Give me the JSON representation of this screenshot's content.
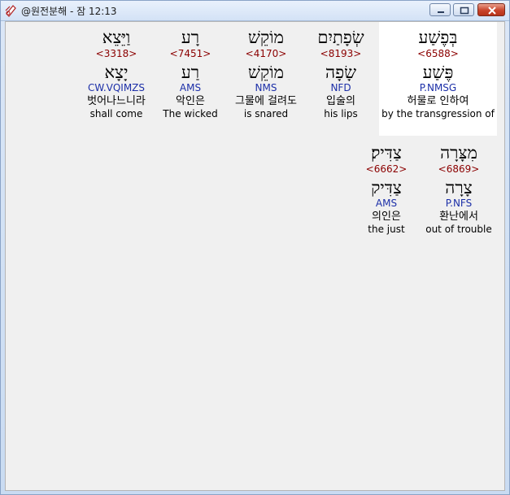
{
  "window": {
    "title": "@원전분해 - 잠 12:13",
    "buttons": {
      "minimize": "minimize-icon",
      "maximize": "maximize-icon",
      "close": "close-icon"
    }
  },
  "colors": {
    "strong": "#8b0000",
    "morph": "#1c2fa8",
    "highlight_bg": "#ffffff",
    "content_bg": "#f0f0f0"
  },
  "words": [
    {
      "hebrew": "בְּפֶשַׁע",
      "strong": "<6588>",
      "lemma": "פֶּשַׁע",
      "morph": "P.NMSG",
      "korean": "허물로 인하여",
      "english": "by the transgression of",
      "highlighted": true
    },
    {
      "hebrew": "שְׂפָתַיִם",
      "strong": "<8193>",
      "lemma": "שָׂפָה",
      "morph": "NFD",
      "korean": "입술의",
      "english": "his lips",
      "highlighted": false
    },
    {
      "hebrew": "מוֹקֵשׁ",
      "strong": "<4170>",
      "lemma": "מוֹקֵשׁ",
      "morph": "NMS",
      "korean": "그물에 걸려도",
      "english": "is snared",
      "highlighted": false
    },
    {
      "hebrew": "רָע",
      "strong": "<7451>",
      "lemma": "רַע",
      "morph": "AMS",
      "korean": "악인은",
      "english": "The wicked",
      "highlighted": false
    },
    {
      "hebrew": "וַיֵּצֵא",
      "strong": "<3318>",
      "lemma": "יָצָא",
      "morph": "CW.VQIMZS",
      "korean": "벗어나느니라",
      "english": "shall come",
      "highlighted": false
    },
    {
      "hebrew": "מִצָּרָה",
      "strong": "<6869>",
      "lemma": "צָרָה",
      "morph": "P.NFS",
      "korean": "환난에서",
      "english": "out of trouble",
      "highlighted": false
    },
    {
      "hebrew": "צַדִּיק׃",
      "strong": "<6662>",
      "lemma": "צַדִּיק",
      "morph": "AMS",
      "korean": "의인은",
      "english": "the just",
      "highlighted": false
    }
  ]
}
